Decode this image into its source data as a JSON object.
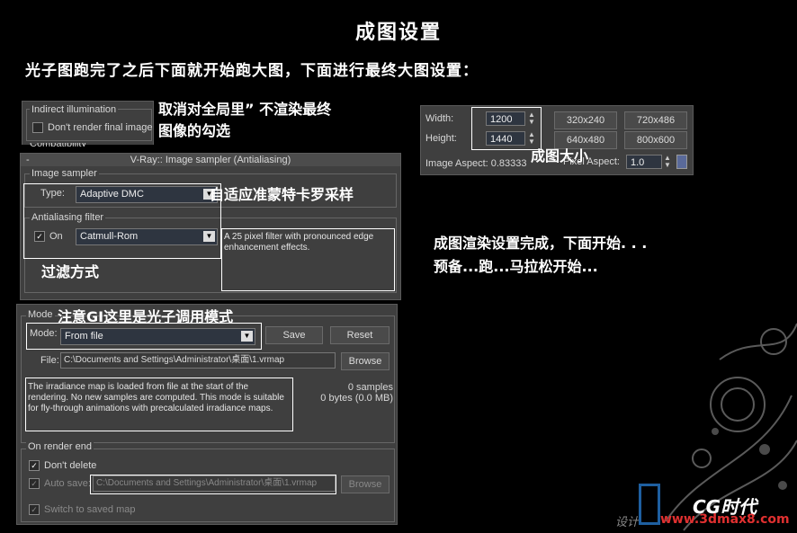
{
  "title": "成图设置",
  "intro": "光子图跑完了之后下面就开始跑大图，下面进行最终大图设置：",
  "annotations": {
    "cancel_render": "取消对全局里” 不渲染最终\n图像的勾选",
    "size": "成图大小",
    "adaptive": "自适应准蒙特卡罗采样",
    "filter": "过滤方式",
    "gi_note": "注意GI这里是光子调用模式",
    "done": "成图渲染设置完成，下面开始. . .\n预备...跑...马拉松开始..."
  },
  "indirect": {
    "group": "Indirect illumination",
    "dont_render": "Don't render final image",
    "partial": "Compatibility"
  },
  "sampler": {
    "window_title": "V-Ray:: Image sampler (Antialiasing)",
    "collapse": "-",
    "image_sampler_group": "Image sampler",
    "type_label": "Type:",
    "type_value": "Adaptive DMC",
    "aa_group": "Antialiasing filter",
    "on_label": "On",
    "filter_value": "Catmull-Rom",
    "filter_desc": "A 25 pixel filter with pronounced edge enhancement effects."
  },
  "output": {
    "width_label": "Width:",
    "width_value": "1200",
    "height_label": "Height:",
    "height_value": "1440",
    "presets": [
      "320x240",
      "720x486",
      "640x480",
      "800x600"
    ],
    "aspect_label": "Image Aspect: 0.83333",
    "pixel_aspect_label": "Pixel Aspect:",
    "pixel_aspect_value": "1.0"
  },
  "irradiance": {
    "mode_group": "Mode",
    "mode_label": "Mode:",
    "mode_value": "From file",
    "save": "Save",
    "reset": "Reset",
    "file_label": "File:",
    "file_value": "C:\\Documents and Settings\\Administrator\\桌面\\1.vrmap",
    "browse": "Browse",
    "desc": "The irradiance map is loaded from file at the start of the rendering. No new samples are computed. This mode is suitable for fly-through animations with precalculated irradiance maps.",
    "samples": "0 samples",
    "bytes": "0 bytes (0.0 MB)",
    "render_end_group": "On render end",
    "dont_delete": "Don't delete",
    "auto_save": "Auto save:",
    "auto_save_path": "C:\\Documents and Settings\\Administrator\\桌面\\1.vrmap",
    "browse2": "Browse",
    "switch_saved": "Switch to saved map"
  },
  "watermark": {
    "left": "设计",
    "logo": "CG时代",
    "url": "www.3dmax8.com"
  }
}
